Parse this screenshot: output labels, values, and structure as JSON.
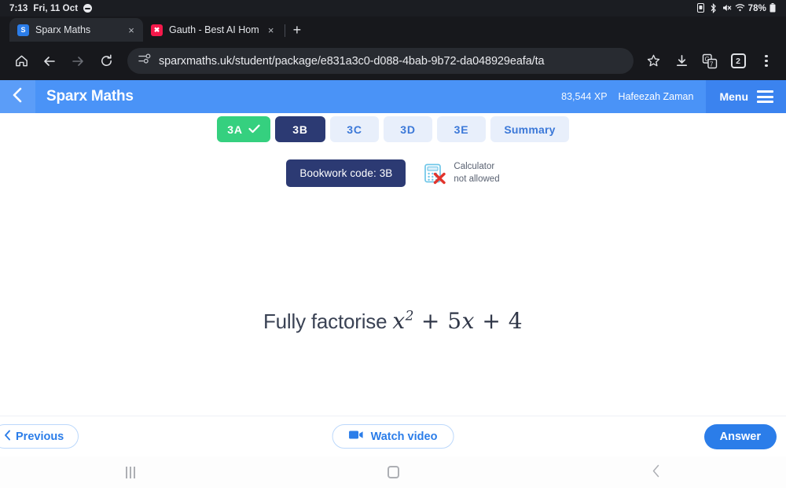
{
  "status_bar": {
    "time": "7:13",
    "date": "Fri, 11 Oct",
    "dnd_icon": "do-not-disturb-icon",
    "icons": [
      "sim-card-icon",
      "bluetooth-icon",
      "mute-icon",
      "wifi-icon"
    ],
    "battery_percent": "78%"
  },
  "browser": {
    "tabs": [
      {
        "title": "Sparx Maths",
        "favicon_letter": "S",
        "active": true
      },
      {
        "title": "Gauth - Best AI Hom",
        "favicon_letter": "✖",
        "active": false
      }
    ],
    "new_tab_label": "+",
    "close_label": "×",
    "toolbar": {
      "home_icon": "home-icon",
      "back_icon": "arrow-back-icon",
      "forward_icon": "arrow-forward-icon",
      "reload_icon": "reload-icon",
      "site_info_icon": "page-settings-icon",
      "url": "sparxmaths.uk/student/package/e831a3c0-d088-4bab-9b72-da048929eafa/ta",
      "bookmark_icon": "star-icon",
      "download_icon": "download-icon",
      "translate_icon": "google-translate-icon",
      "tab_count": "2",
      "menu_icon": "three-dot-menu-icon"
    }
  },
  "app_header": {
    "back_icon": "chevron-left-icon",
    "brand": "Sparx Maths",
    "xp": "83,544 XP",
    "user_name": "Hafeezah Zaman",
    "menu_label": "Menu",
    "menu_icon": "hamburger-icon"
  },
  "question_tabs": [
    {
      "label": "3A",
      "state": "completed",
      "check_icon": "check-icon"
    },
    {
      "label": "3B",
      "state": "current"
    },
    {
      "label": "3C",
      "state": "todo"
    },
    {
      "label": "3D",
      "state": "todo"
    },
    {
      "label": "3E",
      "state": "todo"
    },
    {
      "label": "Summary",
      "state": "summary"
    }
  ],
  "bookwork": {
    "label": "Bookwork code: 3B"
  },
  "calculator": {
    "icon": "calculator-not-allowed-icon",
    "line1": "Calculator",
    "line2": "not allowed"
  },
  "question": {
    "prompt": "Fully factorise ",
    "expression": {
      "var1": "x",
      "exponent": "2",
      "plus1": "+",
      "coef": "5",
      "var2": "x",
      "plus2": "+",
      "constant": "4"
    },
    "plain_text": "Fully factorise x² + 5x + 4"
  },
  "actions": {
    "previous_label": "Previous",
    "previous_icon": "chevron-left-icon",
    "watch_video_label": "Watch video",
    "watch_video_icon": "video-camera-icon",
    "answer_label": "Answer"
  },
  "android_nav": {
    "recents_icon": "recents-icon",
    "home_icon": "home-circle-icon",
    "back_icon": "back-chevron-icon"
  },
  "colors": {
    "header_blue": "#4a93f7",
    "menu_blue": "#3b83ef",
    "accent_blue": "#2b7de9",
    "navy": "#2c3a73",
    "green": "#35d07f",
    "tab_idle": "#e8effb",
    "chrome_dark": "#17181c"
  }
}
